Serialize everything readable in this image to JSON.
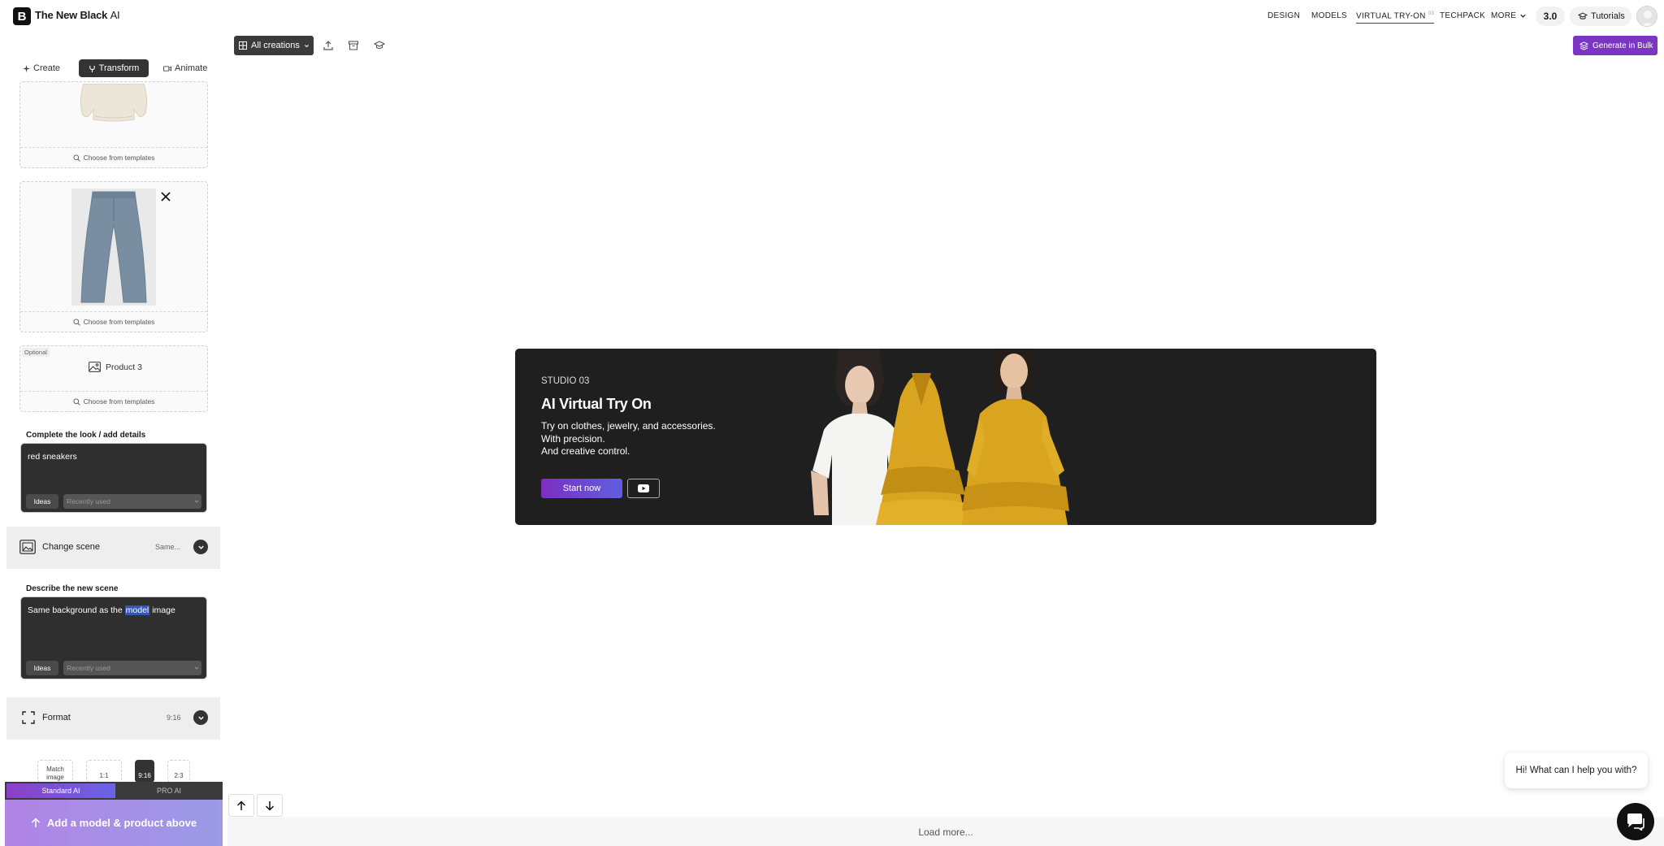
{
  "app": {
    "name": "The New Black",
    "name_suffix": "AI",
    "logo_glyph": "B"
  },
  "nav": {
    "design": "DESIGN",
    "models": "MODELS",
    "virtual_tryon": "VIRTUAL TRY-ON",
    "virtual_tryon_badge": "03",
    "techpack": "TECHPACK",
    "more": "MORE",
    "version": "3.0",
    "tutorials": "Tutorials"
  },
  "sidebar": {
    "tabs": [
      {
        "label": "Create",
        "icon": "sparkle-icon"
      },
      {
        "label": "Transform",
        "icon": "fork-icon"
      },
      {
        "label": "Animate",
        "icon": "video-icon"
      }
    ],
    "slots": {
      "template_label": "Choose from templates",
      "optional_tag": "Optional",
      "product3_label": "Product 3"
    },
    "look": {
      "label": "Complete the look / add details",
      "value": "red sneakers",
      "ideas": "Ideas",
      "recent_placeholder": "Recently used"
    },
    "change_scene": {
      "label": "Change scene",
      "value": "Same..."
    },
    "scene": {
      "label": "Describe the new scene",
      "text_before": "Same background as the ",
      "text_highlight": "model",
      "text_after": " image",
      "ideas": "Ideas",
      "recent_placeholder": "Recently used"
    },
    "format": {
      "label": "Format",
      "value": "9:16"
    },
    "format_options": [
      "Match image",
      "1:1",
      "9:16",
      "2:3"
    ],
    "ai_options": [
      "Standard AI",
      "PRO AI"
    ],
    "cta": "Add a model & product above"
  },
  "main": {
    "filter": "All creations",
    "bulk": "Generate in Bulk",
    "load_more": "Load more..."
  },
  "banner": {
    "eyebrow": "STUDIO 03",
    "title": "AI Virtual Try On",
    "line1": "Try on clothes, jewelry, and accessories.",
    "line2": "With precision.",
    "line3": "And creative control.",
    "start": "Start now"
  },
  "chat": {
    "greeting": "Hi! What can I help you with?"
  },
  "colors": {
    "accent": "#7a35c2",
    "dark": "#1f1f1f",
    "dress": "#d9a520"
  }
}
